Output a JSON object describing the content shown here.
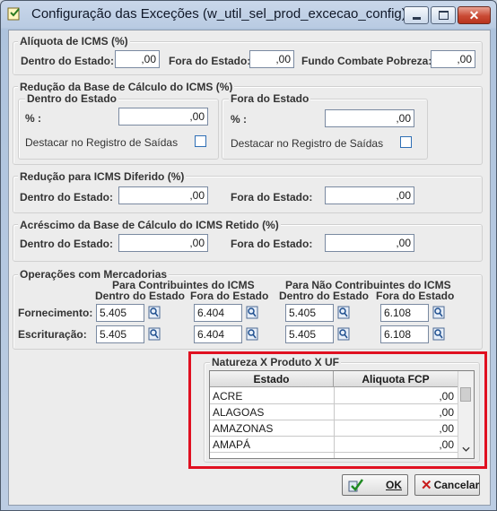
{
  "window": {
    "title": "Configuração das Exceções (w_util_sel_prod_excecao_config)"
  },
  "aliquota": {
    "title": "Alíquota de ICMS (%)",
    "dentro_label": "Dentro do Estado:",
    "dentro_value": ",00",
    "fora_label": "Fora do Estado:",
    "fora_value": ",00",
    "fundo_label": "Fundo Combate Pobreza:",
    "fundo_value": ",00"
  },
  "reducao_base": {
    "title": "Redução da Base de Cálculo do ICMS (%)",
    "dentro": {
      "title": "Dentro do Estado",
      "pct_label": "% :",
      "pct_value": ",00",
      "destacar_label": "Destacar no Registro de Saídas",
      "destacar_checked": false
    },
    "fora": {
      "title": "Fora do Estado",
      "pct_label": "% :",
      "pct_value": ",00",
      "destacar_label": "Destacar no Registro de Saídas",
      "destacar_checked": false
    }
  },
  "reducao_diferido": {
    "title": "Redução para ICMS Diferido (%)",
    "dentro_label": "Dentro do Estado:",
    "dentro_value": ",00",
    "fora_label": "Fora do Estado:",
    "fora_value": ",00"
  },
  "acrescimo": {
    "title": "Acréscimo da Base de Cálculo do ICMS Retido (%)",
    "dentro_label": "Dentro do Estado:",
    "dentro_value": ",00",
    "fora_label": "Fora do Estado:",
    "fora_value": ",00"
  },
  "operacoes": {
    "title": "Operações com Mercadorias",
    "contribuintes_title": "Para Contribuintes do ICMS",
    "nao_contribuintes_title": "Para Não Contribuintes do ICMS",
    "col_dentro": "Dentro do Estado",
    "col_fora": "Fora do Estado",
    "fornecimento_label": "Fornecimento:",
    "escrituracao_label": "Escrituração:",
    "fornecimento": [
      "5.405",
      "6.404",
      "5.405",
      "6.108"
    ],
    "escrituracao": [
      "5.405",
      "6.404",
      "5.405",
      "6.108"
    ]
  },
  "natureza": {
    "title": "Natureza X Produto X UF",
    "headers": [
      "Estado",
      "Aliquota FCP"
    ],
    "rows": [
      {
        "estado": "ACRE",
        "aliquota": ",00"
      },
      {
        "estado": "ALAGOAS",
        "aliquota": ",00"
      },
      {
        "estado": "AMAZONAS",
        "aliquota": ",00"
      },
      {
        "estado": "AMAPÁ",
        "aliquota": ",00"
      }
    ]
  },
  "buttons": {
    "ok": "OK",
    "cancel": "Cancelar"
  },
  "colors": {
    "highlight_border": "#e01020",
    "check_border": "#2f6fb5"
  },
  "icons": [
    "app-icon",
    "lookup-icon",
    "ok-check-icon",
    "cancel-x-icon",
    "scroll-down-icon"
  ]
}
